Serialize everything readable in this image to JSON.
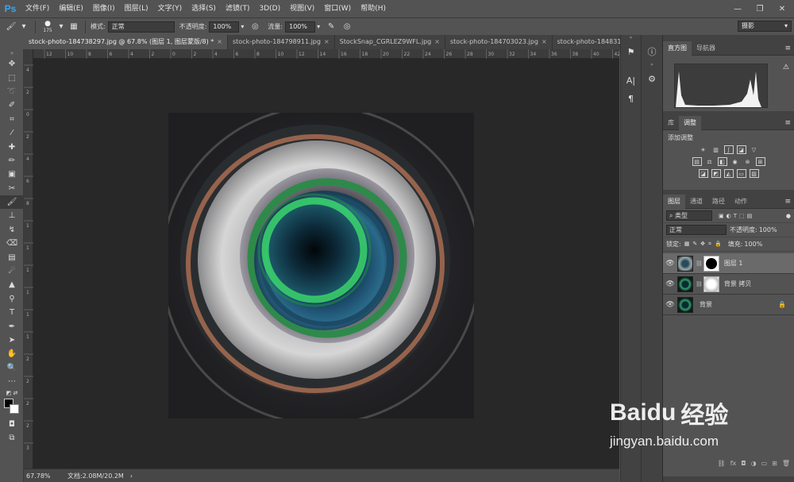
{
  "app": {
    "logo": "Ps"
  },
  "menu": [
    "文件(F)",
    "编辑(E)",
    "图像(I)",
    "图层(L)",
    "文字(Y)",
    "选择(S)",
    "滤镜(T)",
    "3D(D)",
    "视图(V)",
    "窗口(W)",
    "帮助(H)"
  ],
  "options": {
    "brush_size": "175",
    "mode_label": "模式:",
    "mode_value": "正常",
    "opacity_label": "不透明度:",
    "opacity_value": "100%",
    "flow_label": "流量:",
    "flow_value": "100%",
    "workspace": "摄影"
  },
  "tabs": [
    {
      "label": "stock-photo-184738297.jpg @ 67.8% (图层 1, 图层蒙版/8) *"
    },
    {
      "label": "stock-photo-184798911.jpg"
    },
    {
      "label": "StockSnap_CGRLEZ9WFL.jpg"
    },
    {
      "label": "stock-photo-184703023.jpg"
    },
    {
      "label": "stock-photo-184831101.jp"
    }
  ],
  "ruler": {
    "h_ticks": [
      "12",
      "10",
      "8",
      "6",
      "4",
      "2",
      "0",
      "2",
      "4",
      "6",
      "8",
      "10",
      "12",
      "14",
      "16",
      "18",
      "20",
      "22",
      "24",
      "26",
      "28",
      "30",
      "32",
      "34",
      "36",
      "38",
      "40",
      "42"
    ],
    "v_ticks": [
      "4",
      "2",
      "0",
      "2",
      "4",
      "6",
      "8",
      "1",
      "1",
      "1",
      "1",
      "1",
      "1",
      "2",
      "2",
      "2",
      "2",
      "3"
    ]
  },
  "status": {
    "zoom": "67.78%",
    "doc": "文档:2.08M/20.2M"
  },
  "panels": {
    "histogram_tabs": [
      "直方图",
      "导航器"
    ],
    "adjust_tabs": [
      "库",
      "调整"
    ],
    "adjust_title": "添加调整",
    "layers_tabs": [
      "图层",
      "通道",
      "路径",
      "动作"
    ],
    "filter_kind": "类型",
    "blend_mode": "正常",
    "opacity_label": "不透明度:",
    "opacity_value": "100%",
    "lock_label": "锁定:",
    "fill_label": "填充:",
    "fill_value": "100%",
    "layers": [
      {
        "name": "图层 1"
      },
      {
        "name": "背景 拷贝"
      },
      {
        "name": "背景"
      }
    ]
  },
  "watermark": {
    "brand": "Baidu",
    "brand_cn": "经验",
    "url": "jingyan.baidu.com"
  }
}
